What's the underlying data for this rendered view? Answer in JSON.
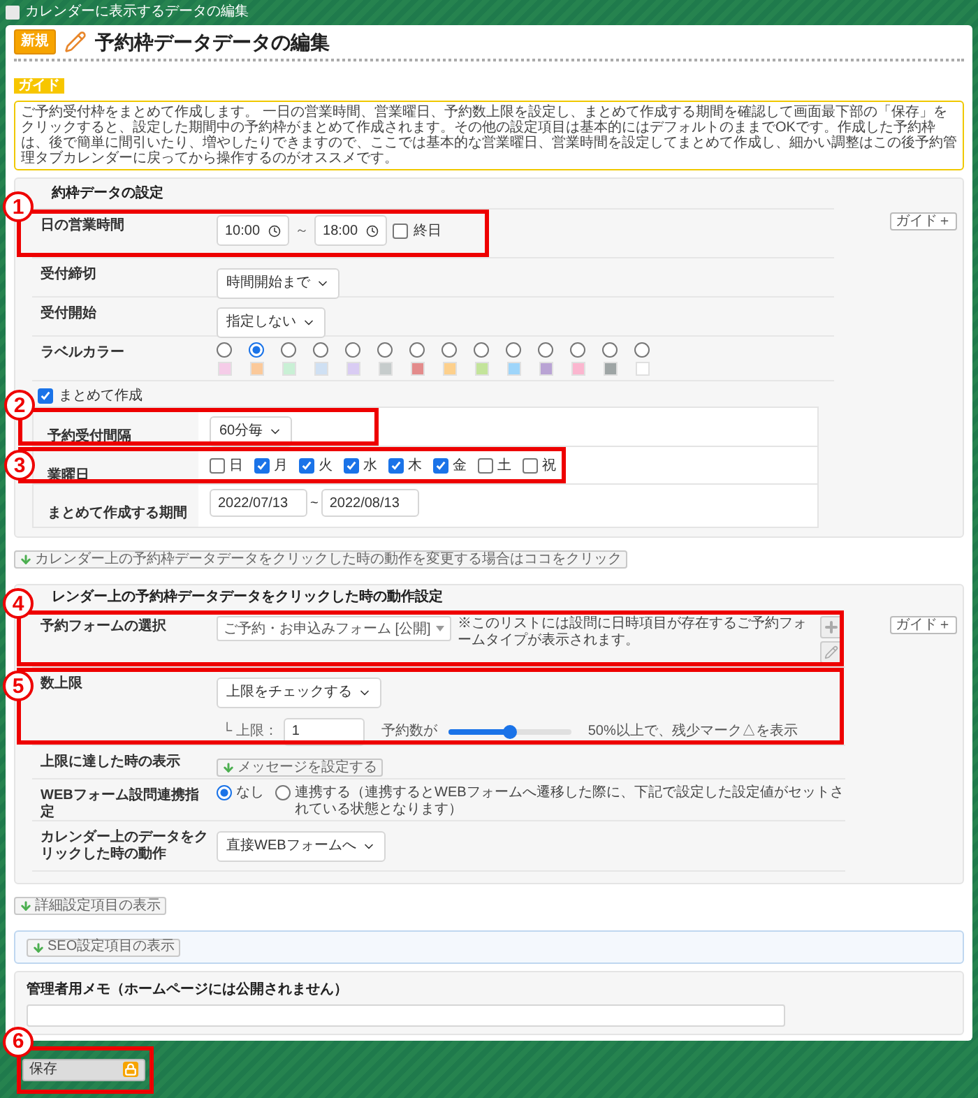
{
  "window": {
    "title": "カレンダーに表示するデータの編集"
  },
  "header": {
    "badge": "新規",
    "title": "予約枠データデータの編集"
  },
  "guide": {
    "tag": "ガイド",
    "text": "ご予約受付枠をまとめて作成します。 一日の営業時間、営業曜日、予約数上限を設定し、まとめて作成する期間を確認して画面最下部の「保存」をクリックすると、設定した期間中の予約枠がまとめて作成されます。その他の設定項目は基本的にはデフォルトのままでOKです。作成した予約枠は、後で簡単に間引いたり、増やしたりできますので、ここでは基本的な営業曜日、営業時間を設定してまとめて作成し、細かい調整はこの後予約管理タブカレンダーに戻ってから操作するのがオススメです。"
  },
  "section_1": {
    "heading": "約枠データの設定",
    "guide_button": "ガイド＋",
    "business_hours": {
      "label": "日の営業時間",
      "start": "10:00",
      "separator": "～",
      "end": "18:00",
      "all_day": {
        "label": "終日",
        "checked": false
      }
    },
    "deadline": {
      "label": "受付締切",
      "value": "時間開始まで"
    },
    "opening": {
      "label": "受付開始",
      "value": "指定しない"
    },
    "label_color": {
      "label": "ラベルカラー",
      "options": [
        {
          "color": "#f5cce8",
          "selected": false
        },
        {
          "color": "#fbc99a",
          "selected": true
        },
        {
          "color": "#c9f0d5",
          "selected": false
        },
        {
          "color": "#cfe0f3",
          "selected": false
        },
        {
          "color": "#d9ccf3",
          "selected": false
        },
        {
          "color": "#c6cccc",
          "selected": false
        },
        {
          "color": "#e38b8b",
          "selected": false
        },
        {
          "color": "#fdd08c",
          "selected": false
        },
        {
          "color": "#c3e49a",
          "selected": false
        },
        {
          "color": "#9ed5fa",
          "selected": false
        },
        {
          "color": "#b9a3d4",
          "selected": false
        },
        {
          "color": "#fbb6cf",
          "selected": false
        },
        {
          "color": "#9ea5a5",
          "selected": false
        },
        {
          "color": "#ffffff",
          "selected": false
        }
      ]
    },
    "bulk": {
      "label": "まとめて作成",
      "checked": true,
      "interval": {
        "label": "予約受付間隔",
        "value": "60分毎"
      },
      "weekdays": {
        "label": "業曜日",
        "days": [
          {
            "label": "日",
            "checked": false
          },
          {
            "label": "月",
            "checked": true
          },
          {
            "label": "火",
            "checked": true
          },
          {
            "label": "水",
            "checked": true
          },
          {
            "label": "木",
            "checked": true
          },
          {
            "label": "金",
            "checked": true
          },
          {
            "label": "土",
            "checked": false
          },
          {
            "label": "祝",
            "checked": false
          }
        ]
      },
      "period": {
        "label": "まとめて作成する期間",
        "start": "2022/07/13",
        "separator": "~",
        "end": "2022/08/13"
      }
    }
  },
  "toggle_button": "カレンダー上の予約枠データデータをクリックした時の動作を変更する場合はココをクリック",
  "section_2": {
    "heading": "レンダー上の予約枠データデータをクリックした時の動作設定",
    "guide_button": "ガイド＋",
    "form_select": {
      "label": "予約フォームの選択",
      "value": "ご予約・お申込みフォーム [公開]",
      "note": "※このリストには設問に日時項目が存在するご予約フォームタイプが表示されます。"
    },
    "limit": {
      "label": "数上限",
      "value": "上限をチェックする",
      "sub_label": "└ 上限：",
      "input": "1",
      "slider_label": "予約数が",
      "level": 0.5,
      "reading": "50%以上で、残少マーク△を表示"
    },
    "full_display": {
      "label": "上限に達した時の表示",
      "button": "メッセージを設定する"
    },
    "web_link": {
      "label": "WEBフォーム設問連携指定",
      "options": [
        {
          "label": "なし",
          "selected": true
        },
        {
          "label": "連携する（連携するとWEBフォームへ遷移した際に、下記で設定した設定値がセットされている状態となります）",
          "selected": false
        }
      ]
    },
    "click_action": {
      "label": "カレンダー上のデータをクリックした時の動作",
      "value": "直接WEBフォームへ"
    }
  },
  "detail_button": "詳細設定項目の表示",
  "seo_button": "SEO設定項目の表示",
  "memo": {
    "heading": "管理者用メモ（ホームページには公開されません）"
  },
  "save_button": "保存",
  "callouts": [
    {
      "number": "1"
    },
    {
      "number": "2"
    },
    {
      "number": "3"
    },
    {
      "number": "4"
    },
    {
      "number": "5"
    },
    {
      "number": "6"
    }
  ]
}
